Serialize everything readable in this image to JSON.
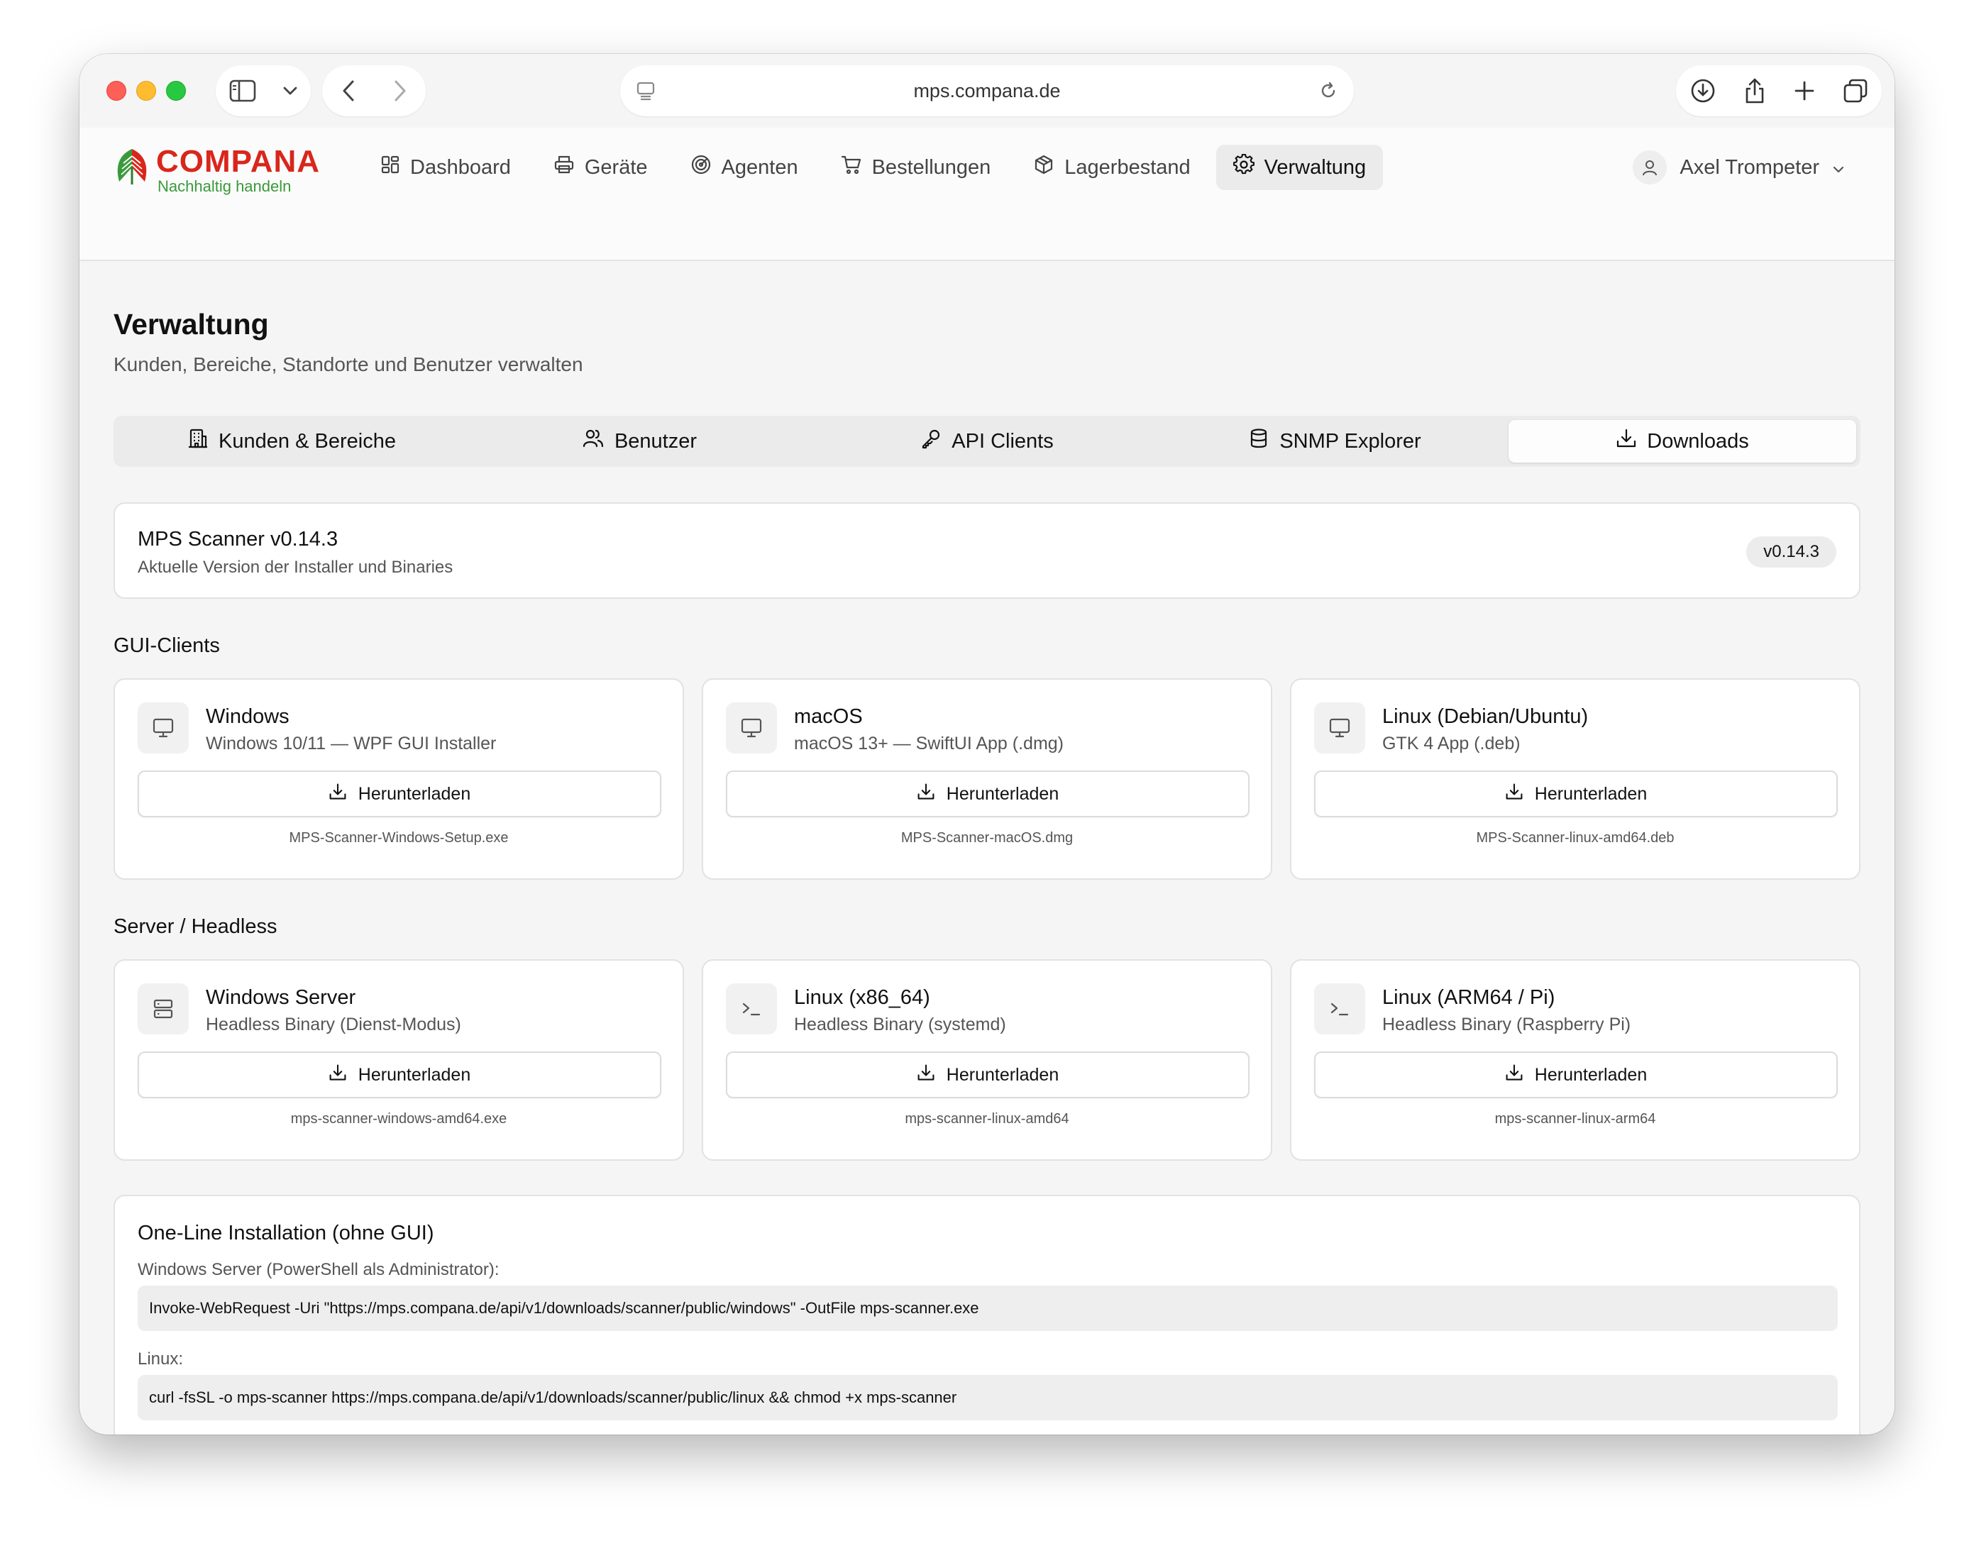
{
  "browser": {
    "url": "mps.compana.de"
  },
  "brand": {
    "name": "COMPANA",
    "tagline": "Nachhaltig handeln",
    "colors": {
      "primary_red": "#d9261c",
      "green": "#3a9a3a"
    }
  },
  "nav": {
    "items": [
      {
        "label": "Dashboard",
        "icon": "dashboard-icon"
      },
      {
        "label": "Geräte",
        "icon": "printer-icon"
      },
      {
        "label": "Agenten",
        "icon": "radar-icon"
      },
      {
        "label": "Bestellungen",
        "icon": "cart-icon"
      },
      {
        "label": "Lagerbestand",
        "icon": "package-icon"
      },
      {
        "label": "Verwaltung",
        "icon": "gear-icon",
        "active": true
      }
    ],
    "user": "Axel Trompeter"
  },
  "page": {
    "title": "Verwaltung",
    "subtitle": "Kunden, Bereiche, Standorte und Benutzer verwalten"
  },
  "tabs": [
    {
      "label": "Kunden & Bereiche",
      "icon": "building-icon"
    },
    {
      "label": "Benutzer",
      "icon": "users-icon"
    },
    {
      "label": "API Clients",
      "icon": "key-icon"
    },
    {
      "label": "SNMP Explorer",
      "icon": "database-icon"
    },
    {
      "label": "Downloads",
      "icon": "download-icon",
      "active": true
    }
  ],
  "version": {
    "title": "MPS Scanner v0.14.3",
    "description": "Aktuelle Version der Installer und Binaries",
    "badge": "v0.14.3"
  },
  "gui_clients": {
    "heading": "GUI-Clients",
    "items": [
      {
        "title": "Windows",
        "description": "Windows 10/11 — WPF GUI Installer",
        "button": "Herunterladen",
        "file": "MPS-Scanner-Windows-Setup.exe",
        "icon": "monitor-icon"
      },
      {
        "title": "macOS",
        "description": "macOS 13+ — SwiftUI App (.dmg)",
        "button": "Herunterladen",
        "file": "MPS-Scanner-macOS.dmg",
        "icon": "monitor-icon"
      },
      {
        "title": "Linux (Debian/Ubuntu)",
        "description": "GTK 4 App (.deb)",
        "button": "Herunterladen",
        "file": "MPS-Scanner-linux-amd64.deb",
        "icon": "monitor-icon"
      }
    ]
  },
  "server": {
    "heading": "Server / Headless",
    "items": [
      {
        "title": "Windows Server",
        "description": "Headless Binary (Dienst-Modus)",
        "button": "Herunterladen",
        "file": "mps-scanner-windows-amd64.exe",
        "icon": "server-icon"
      },
      {
        "title": "Linux (x86_64)",
        "description": "Headless Binary (systemd)",
        "button": "Herunterladen",
        "file": "mps-scanner-linux-amd64",
        "icon": "terminal-icon"
      },
      {
        "title": "Linux (ARM64 / Pi)",
        "description": "Headless Binary (Raspberry Pi)",
        "button": "Herunterladen",
        "file": "mps-scanner-linux-arm64",
        "icon": "terminal-icon"
      }
    ]
  },
  "oneline": {
    "title": "One-Line Installation (ohne GUI)",
    "windows_label": "Windows Server (PowerShell als Administrator):",
    "windows_cmd": "Invoke-WebRequest -Uri \"https://mps.compana.de/api/v1/downloads/scanner/public/windows\" -OutFile mps-scanner.exe",
    "linux_label": "Linux:",
    "linux_cmd": "curl -fsSL -o mps-scanner https://mps.compana.de/api/v1/downloads/scanner/public/linux && chmod +x mps-scanner"
  }
}
